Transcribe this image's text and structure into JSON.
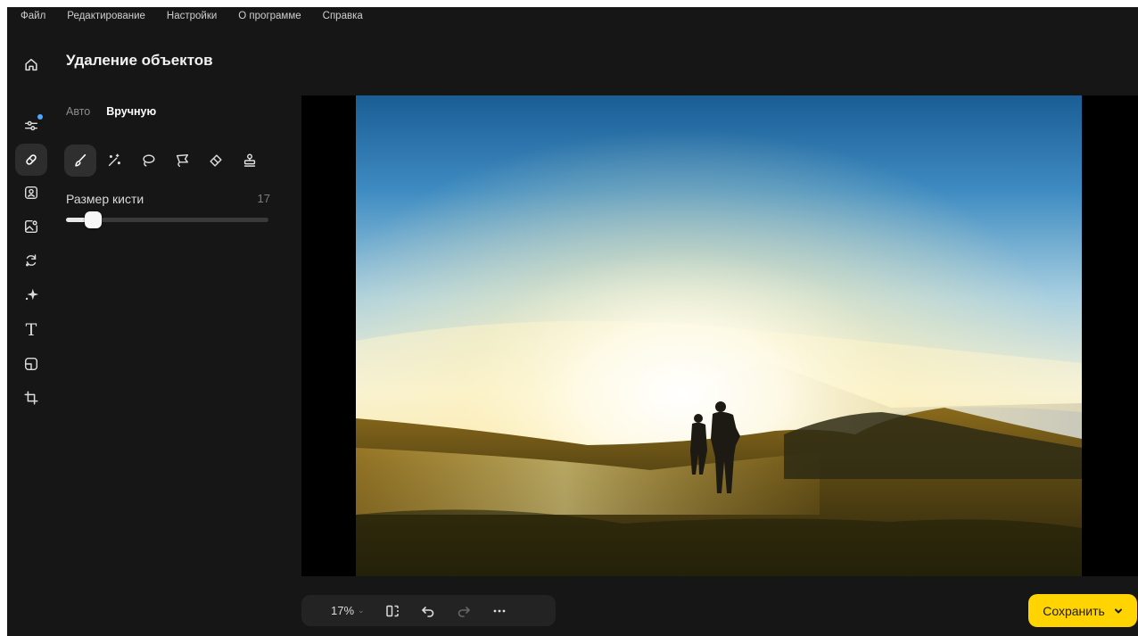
{
  "menu": [
    "Файл",
    "Редактирование",
    "Настройки",
    "О программе",
    "Справка"
  ],
  "page_title": "Удаление объектов",
  "rail": [
    {
      "icon": "adjustments-icon",
      "active": false,
      "badge": true
    },
    {
      "icon": "eraser-patch-icon",
      "active": true
    },
    {
      "icon": "portrait-icon",
      "active": false
    },
    {
      "icon": "image-replace-icon",
      "active": false
    },
    {
      "icon": "sync-icon",
      "active": false
    },
    {
      "icon": "sparkle-icon",
      "active": false
    },
    {
      "icon": "text-icon",
      "active": false,
      "glyph": "T"
    },
    {
      "icon": "frame-icon",
      "active": false
    },
    {
      "icon": "crop-icon",
      "active": false
    }
  ],
  "tabs": {
    "auto": "Авто",
    "manual": "Вручную",
    "active": "manual"
  },
  "tools": [
    "brush-icon",
    "magic-wand-icon",
    "lasso-icon",
    "polygon-lasso-icon",
    "eraser-icon",
    "clone-stamp-icon"
  ],
  "brush": {
    "label": "Размер кисти",
    "value": "17",
    "level": 0.12
  },
  "zoom": {
    "value": "17%"
  },
  "save": {
    "label": "Сохранить"
  },
  "colors": {
    "accent": "#ffd400",
    "badge": "#4ea7ff",
    "background": "#161616"
  }
}
